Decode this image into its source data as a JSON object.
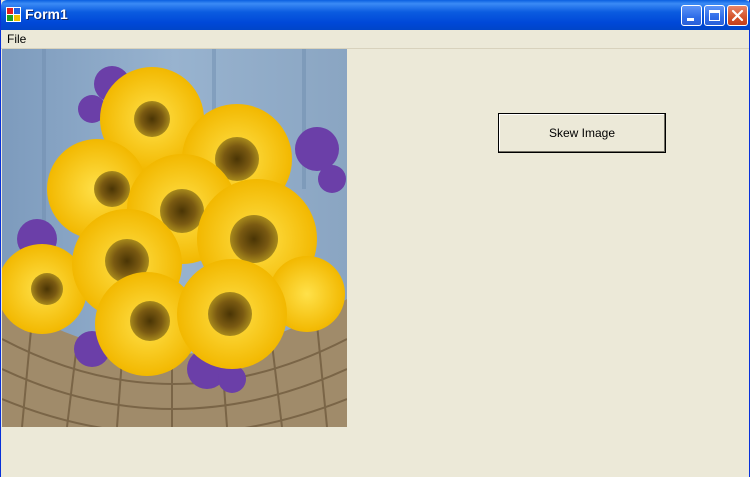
{
  "window": {
    "title": "Form1"
  },
  "menu": {
    "items": [
      {
        "label": "File"
      }
    ]
  },
  "picture": {
    "subject": "sunflower-bouquet-in-basket"
  },
  "buttons": {
    "skew_label": "Skew Image"
  },
  "icons": {
    "app": "form-icon",
    "minimize": "minimize-icon",
    "maximize": "maximize-icon",
    "close": "close-icon"
  },
  "colors": {
    "titlebar": "#0b5ce0",
    "close_button": "#d4532a",
    "client_area": "#ece9d8"
  }
}
